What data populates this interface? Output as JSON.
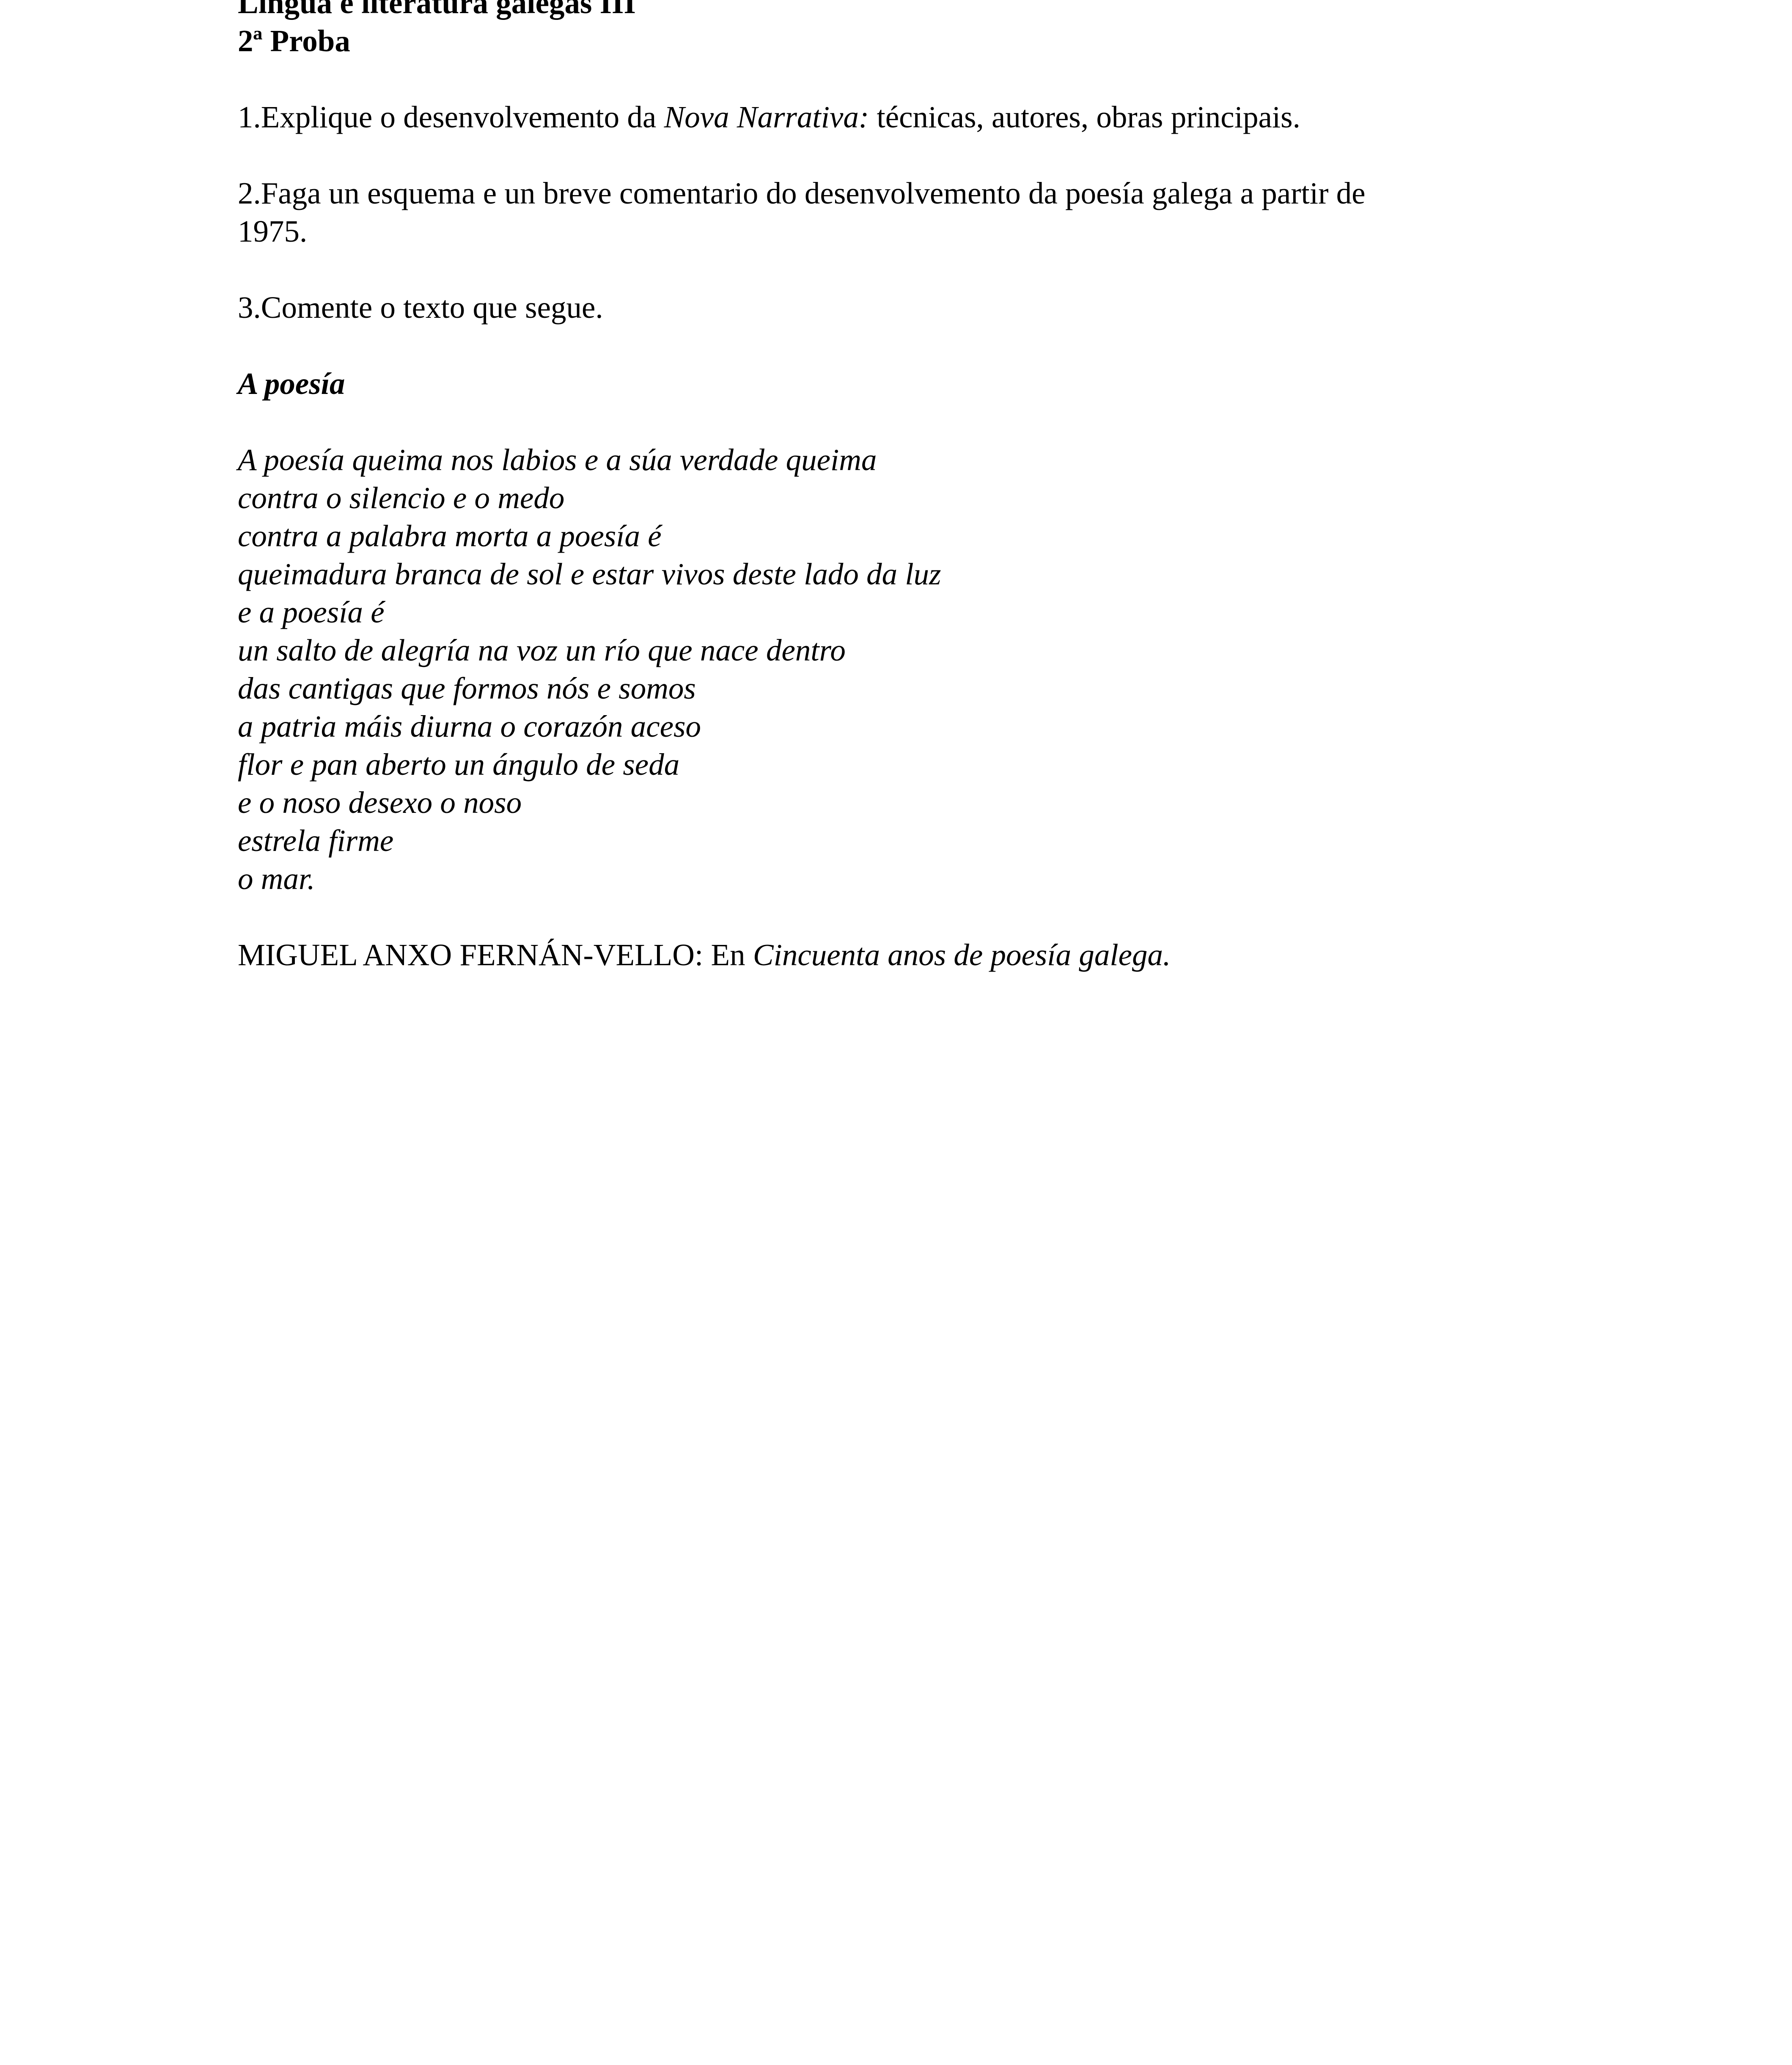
{
  "header": {
    "course": "Lingua e literatura galegas III",
    "exam": "2ª Proba"
  },
  "questions": [
    {
      "number": "1.",
      "before_italic": "Explique o desenvolvemento da ",
      "italic": "Nova Narrativa:",
      "after_italic": " técnicas, autores, obras principais."
    },
    {
      "number": "2.",
      "text": "Faga un esquema e un breve comentario do desenvolvemento da poesía galega a partir de 1975."
    },
    {
      "number": "3.",
      "text": "Comente o texto que segue."
    }
  ],
  "poem": {
    "title": "A poesía",
    "lines": [
      "A poesía queima nos labios e a súa verdade queima",
      "contra o silencio e o medo",
      "contra a palabra morta a poesía é",
      "queimadura branca de sol e estar vivos deste lado da luz",
      "e a poesía é",
      "un salto de alegría na voz un río que nace dentro",
      "das cantigas que formos nós e somos",
      "a patria máis diurna o corazón aceso",
      "flor e pan aberto un ángulo de seda",
      "e o noso desexo o noso",
      "estrela firme",
      "o mar."
    ]
  },
  "source": {
    "author_prefix": "MIGUEL ANXO FERNÁN-VELLO: En ",
    "book": "Cincuenta anos de poesía galega."
  }
}
